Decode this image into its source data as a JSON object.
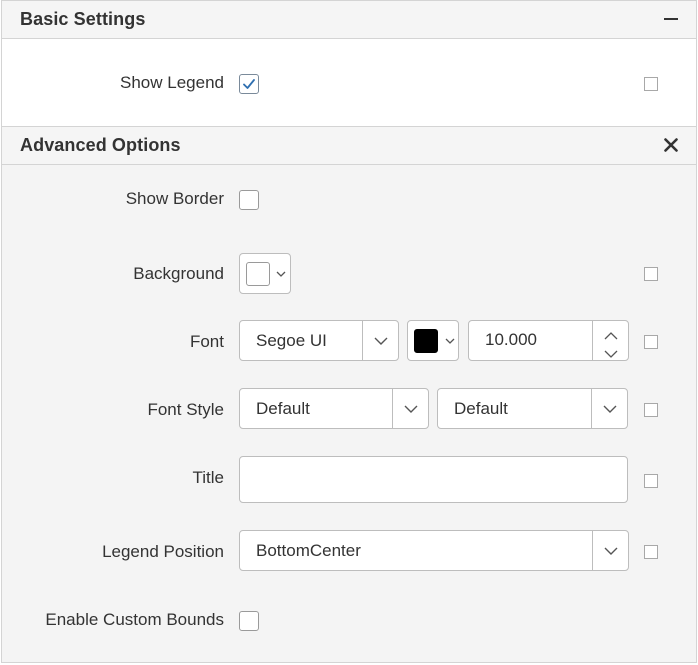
{
  "basic_settings": {
    "title": "Basic Settings",
    "collapse_icon": "minus-icon",
    "show_legend": {
      "label": "Show Legend",
      "checked": true
    }
  },
  "advanced_options": {
    "title": "Advanced Options",
    "close_icon": "close-icon",
    "show_border": {
      "label": "Show Border",
      "checked": false
    },
    "background": {
      "label": "Background",
      "color": "#ffffff"
    },
    "font": {
      "label": "Font",
      "family": "Segoe UI",
      "color": "#000000",
      "size": "10.000"
    },
    "font_style": {
      "label": "Font Style",
      "style_value": "Default",
      "weight_value": "Default"
    },
    "title_field": {
      "label": "Title",
      "value": ""
    },
    "legend_position": {
      "label": "Legend Position",
      "value": "BottomCenter"
    },
    "enable_custom_bounds": {
      "label": "Enable Custom Bounds",
      "checked": false
    }
  },
  "colors": {
    "border": "#d4d4d4",
    "header_bg": "#f5f5f5",
    "panel_bg": "#f4f4f4",
    "text": "#333333"
  }
}
